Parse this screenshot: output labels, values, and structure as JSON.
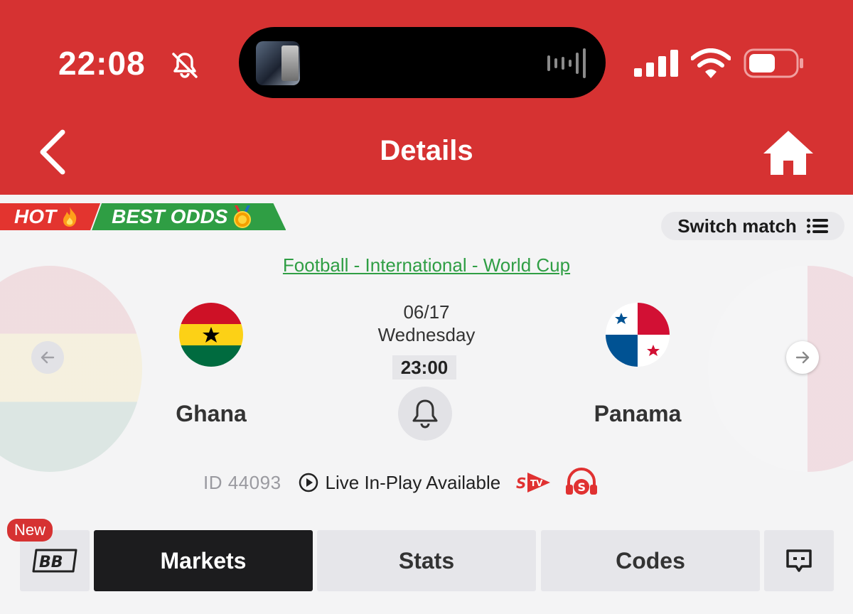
{
  "status_bar": {
    "time": "22:08",
    "icons": [
      "bell-slash-icon",
      "album-art",
      "audio-waveform-icon",
      "cellular-signal-icon",
      "wifi-icon",
      "battery-icon"
    ]
  },
  "header": {
    "title": "Details",
    "back_icon": "chevron-left-icon",
    "home_icon": "home-icon",
    "color": "#d63232"
  },
  "badges": {
    "hot": "HOT",
    "best_odds": "BEST ODDS"
  },
  "switch_match": {
    "label": "Switch match"
  },
  "match": {
    "competition": "Football - International - World Cup",
    "date": "06/17",
    "day": "Wednesday",
    "time": "23:00",
    "home_team": "Ghana",
    "away_team": "Panama",
    "id": "ID 44093",
    "live_text": "Live In-Play Available"
  },
  "tabs": {
    "new_badge": "New",
    "bb": "BB",
    "markets": "Markets",
    "stats": "Stats",
    "codes": "Codes"
  },
  "colors": {
    "accent_red": "#d63232",
    "accent_green": "#2f9e44",
    "active_tab": "#1c1c1e"
  }
}
